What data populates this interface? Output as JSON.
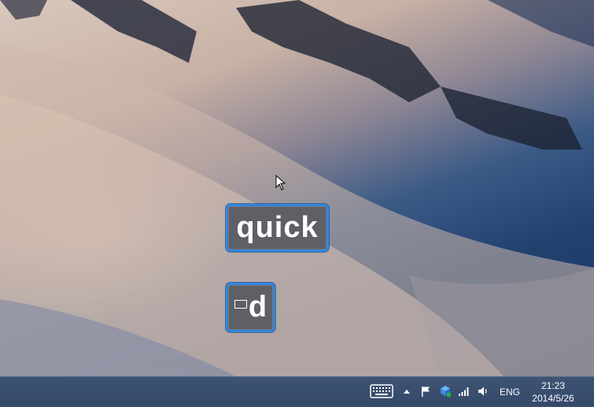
{
  "desktop": {
    "wallpaper": "snowy-mountain-slope",
    "colors": {
      "sky_shadow": "#1b3a66",
      "snow_lit": "#d9c8bd",
      "osd_border": "#2f86e0",
      "osd_fill": "#5f5f66"
    }
  },
  "osd": {
    "typed_word": "quick",
    "key_label": "d",
    "key_glyph": "placeholder-box"
  },
  "taskbar": {
    "tray": {
      "language": "ENG",
      "time": "21:23",
      "date": "2014/5/26",
      "icons": [
        "keyboard-icon",
        "chevron-up-icon",
        "flag-icon",
        "network-share-icon",
        "signal-icon",
        "volume-icon"
      ]
    }
  }
}
